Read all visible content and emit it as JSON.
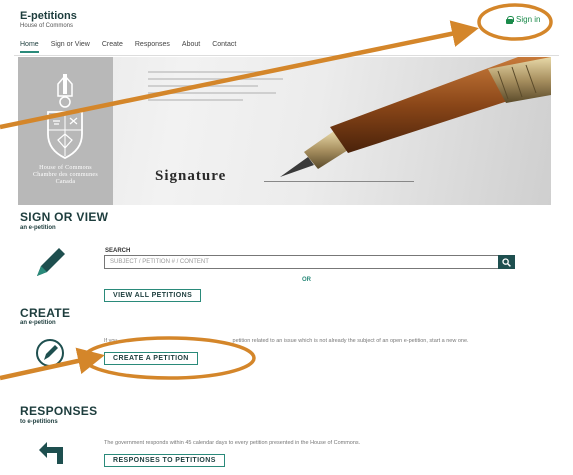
{
  "header": {
    "title": "E-petitions",
    "subtitle": "House of Commons",
    "sign_in": "Sign in"
  },
  "nav": {
    "items": [
      "Home",
      "Sign or View",
      "Create",
      "Responses",
      "About",
      "Contact"
    ],
    "active": "Home"
  },
  "banner": {
    "crest_lines": [
      "House of Commons",
      "Chambre des communes",
      "Canada"
    ],
    "signature_word": "Signature"
  },
  "sign_or_view": {
    "heading": "SIGN OR VIEW",
    "subheading": "an e-petition",
    "search_label": "SEARCH",
    "search_placeholder": "SUBJECT / PETITION # / CONTENT",
    "or_label": "OR",
    "view_all_button": "VIEW ALL PETITIONS"
  },
  "create": {
    "heading": "CREATE",
    "subheading": "an e-petition",
    "description_visible": "petition related to an issue which is not already the subject of an open e-petition, start a new one.",
    "description_prefix": "If you",
    "create_button": "CREATE A PETITION"
  },
  "responses": {
    "heading": "RESPONSES",
    "subheading": "to e-petitions",
    "description": "The government responds within 45 calendar days to every petition presented in the House of Commons.",
    "responses_button": "RESPONSES TO PETITIONS"
  },
  "colors": {
    "brand_dark": "#1d3d3d",
    "accent_teal": "#2a8a7a",
    "signin_green": "#1a8a4a",
    "annotation_orange": "#d4862a"
  }
}
